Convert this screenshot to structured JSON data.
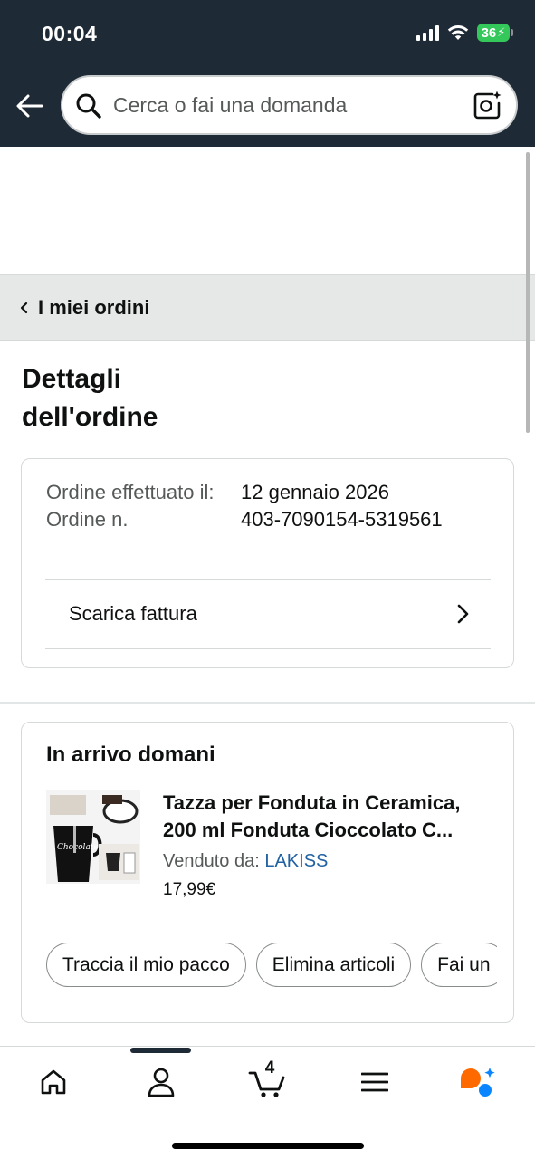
{
  "status_bar": {
    "time": "00:04",
    "battery": "36"
  },
  "search": {
    "placeholder": "Cerca o fai una domanda"
  },
  "breadcrumb": {
    "label": "I miei ordini"
  },
  "page": {
    "title": "Dettagli dell'ordine"
  },
  "order": {
    "placed_label": "Ordine effettuato il:",
    "number_label": "Ordine n.",
    "date": "12 gennaio 2026",
    "number": "403-7090154-5319561",
    "invoice_label": "Scarica fattura"
  },
  "shipment": {
    "status": "In arrivo domani",
    "product_title_line1": "Tazza per Fonduta in Ceramica,",
    "product_title_line2": "200 ml Fonduta Cioccolato C...",
    "sold_by_label": "Venduto da:",
    "seller": "LAKISS",
    "price": "17,99€",
    "actions": [
      "Traccia il mio pacco",
      "Elimina articoli",
      "Fai un"
    ]
  },
  "bottom_nav": {
    "items": [
      "home-icon",
      "account-icon",
      "cart-icon",
      "menu-icon",
      "rufus-icon"
    ],
    "cart_count": "4"
  },
  "colors": {
    "header_bg": "#1f2a37",
    "link": "#2162a1",
    "battery": "#34c759",
    "rufus_orange": "#ff6a00",
    "rufus_blue": "#0a84ff"
  }
}
